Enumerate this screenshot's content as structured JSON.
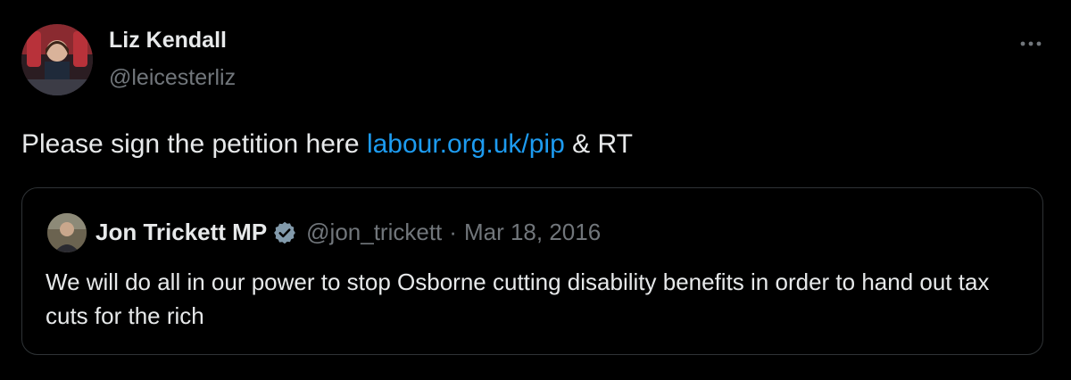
{
  "tweet": {
    "author": {
      "name": "Liz Kendall",
      "handle": "@leicesterliz"
    },
    "text_before_link": "Please sign the petition here ",
    "link_text": "labour.org.uk/pip",
    "text_after_link": " & RT",
    "more_icon": "more-horizontal-icon"
  },
  "quote": {
    "author": {
      "name": "Jon Trickett MP",
      "handle": "@jon_trickett",
      "verified_icon": "verified-badge-icon"
    },
    "separator": "·",
    "date": "Mar 18, 2016",
    "text": "We will do all in our power to stop Osborne cutting disability benefits in order to hand out tax cuts for the rich"
  },
  "colors": {
    "background": "#000000",
    "text": "#e7e9ea",
    "secondary": "#71767b",
    "link": "#1d9bf0",
    "border": "#2f3336"
  }
}
